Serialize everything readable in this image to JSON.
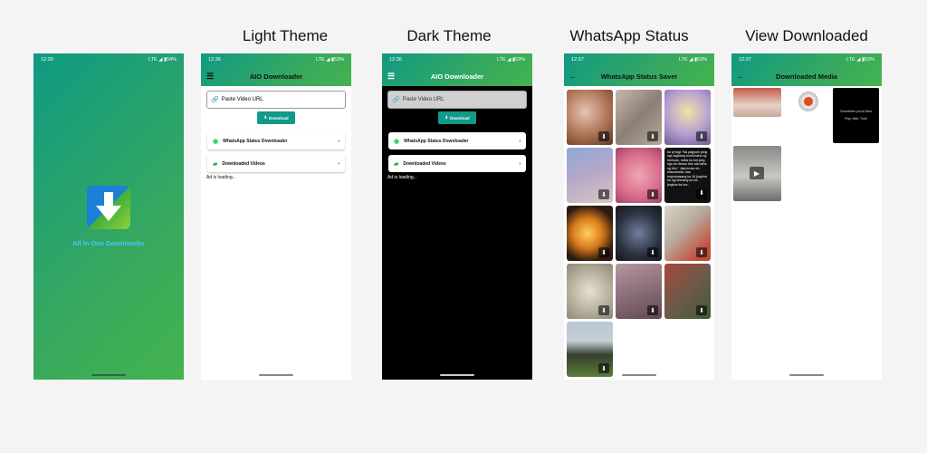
{
  "captions": {
    "light": "Light Theme",
    "dark": "Dark Theme",
    "whatsapp": "WhatsApp Status",
    "downloaded": "View Downloaded"
  },
  "splash": {
    "time": "12:30",
    "signal": "LTE ◢ ▮54%",
    "app_name": "All in One Downloader"
  },
  "light": {
    "time": "12:36",
    "signal": "LTE ◢ ▮53%",
    "title": "AIO Downloader",
    "url_placeholder": "Paste Video URL",
    "download_label": "Download",
    "status_item": "WhatsApp Status Downloader",
    "videos_item": "Downloaded Videos",
    "ad_text": "Ad is loading..."
  },
  "dark": {
    "time": "12:36",
    "signal": "LTE ◢ ▮53%",
    "title": "AIO Downloader",
    "url_placeholder": "Paste Video URL",
    "download_label": "Download",
    "status_item": "WhatsApp Status Downloader",
    "videos_item": "Downloaded Videos",
    "ad_text": "Ad is loading..."
  },
  "whatsapp": {
    "time": "12:37",
    "signal": "LTE ◢ ▮53%",
    "title": "WhatsApp Status Saver",
    "text_tile": "ka iy bagi \"Na pagsure jang ngs tagbang sundi baha ng mnhuan, naba ka bot jong ngs ka hlosse tine ala baha ng ihin.\" Jaja krosa ob.. masuduata, baa sngrowasang ka 16 jingbha ka ngi khmang ka mn jingbha ka bor..."
  },
  "downloaded": {
    "time": "12:37",
    "signal": "LTE ◢ ▮53%",
    "title": "Downloaded Media",
    "black_tile_line1": "Sometimes you're Best",
    "black_tile_line2": "Play, Wait, Truth"
  },
  "colors": {
    "accent": "#119a87",
    "gradient_start": "#0f9a83",
    "gradient_end": "#44b34e"
  }
}
